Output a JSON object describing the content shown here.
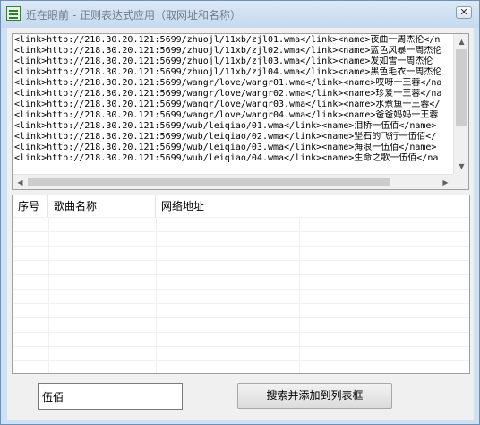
{
  "window": {
    "title": "近在眼前 - 正则表达式应用（取网址和名称）",
    "close_glyph": "✕",
    "app_icon": "grid-app-icon",
    "accent": "#cfe0f2"
  },
  "source": {
    "lines": [
      "<link>http://218.30.20.121:5699/zhuojl/11xb/zjl01.wma</link><name>夜曲一周杰伦</n",
      "<link>http://218.30.20.121:5699/zhuojl/11xb/zjl02.wma</link><name>蓝色风暴一周杰伦",
      "<link>http://218.30.20.121:5699/zhuojl/11xb/zjl03.wma</link><name>发如雪一周杰伦",
      "<link>http://218.30.20.121:5699/zhuojl/11xb/zjl04.wma</link><name>黑色毛衣一周杰伦",
      "<link>http://218.30.20.121:5699/wangr/love/wangr01.wma</link><name>哎呀一王蓉</na",
      "<link>http://218.30.20.121:5699/wangr/love/wangr02.wma</link><name>珍爱一王蓉</na",
      "<link>http://218.30.20.121:5699/wangr/love/wangr03.wma</link><name>水煮鱼一王蓉</",
      "<link>http://218.30.20.121:5699/wangr/love/wangr04.wma</link><name>爸爸妈妈一王蓉",
      "<link>http://218.30.20.121:5699/wub/leiqiao/01.wma</link><name>泪桥一伍佰</name>",
      "<link>http://218.30.20.121:5699/wub/leiqiao/02.wma</link><name>坚石的飞行一伍佰</",
      "<link>http://218.30.20.121:5699/wub/leiqiao/03.wma</link><name>海浪一伍佰</name>",
      "<link>http://218.30.20.121:5699/wub/leiqiao/04.wma</link><name>生命之歌一伍佰</na"
    ],
    "scroll_up": "▲",
    "scroll_down": "▼",
    "scroll_left": "◀",
    "scroll_right": "▶"
  },
  "list": {
    "columns": [
      "序号",
      "歌曲名称",
      "网络地址"
    ],
    "rows": []
  },
  "controls": {
    "keyword_value": "伍佰",
    "search_button_label": "搜索并添加到列表框"
  }
}
